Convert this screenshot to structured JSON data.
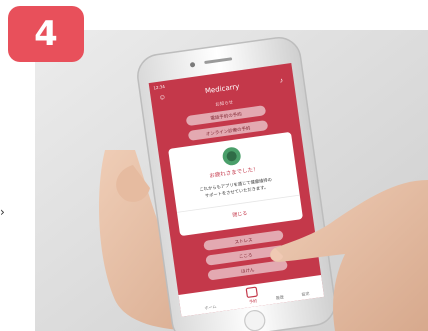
{
  "step_number": "4",
  "flow_arrow": "›",
  "colors": {
    "badge": "#e8505b",
    "app_red": "#c4384a",
    "menu_pill": "#e3a9b1"
  },
  "phone": {
    "status_left": "12:34",
    "app_title": "Medicarry",
    "section_label": "お知らせ",
    "menu_items": [
      "電話予約の予約",
      "オンライン診療の予約",
      "ストレス",
      "こころ",
      "ほけん"
    ],
    "dialog": {
      "title": "お疲れさまでした！",
      "message_line1": "これからもアプリを通じて健康維持の",
      "message_line2": "サポートをさせていただきます。",
      "ok_label": "閉じる"
    },
    "tabs": [
      "ホーム",
      "予約",
      "履歴",
      "設定"
    ]
  }
}
